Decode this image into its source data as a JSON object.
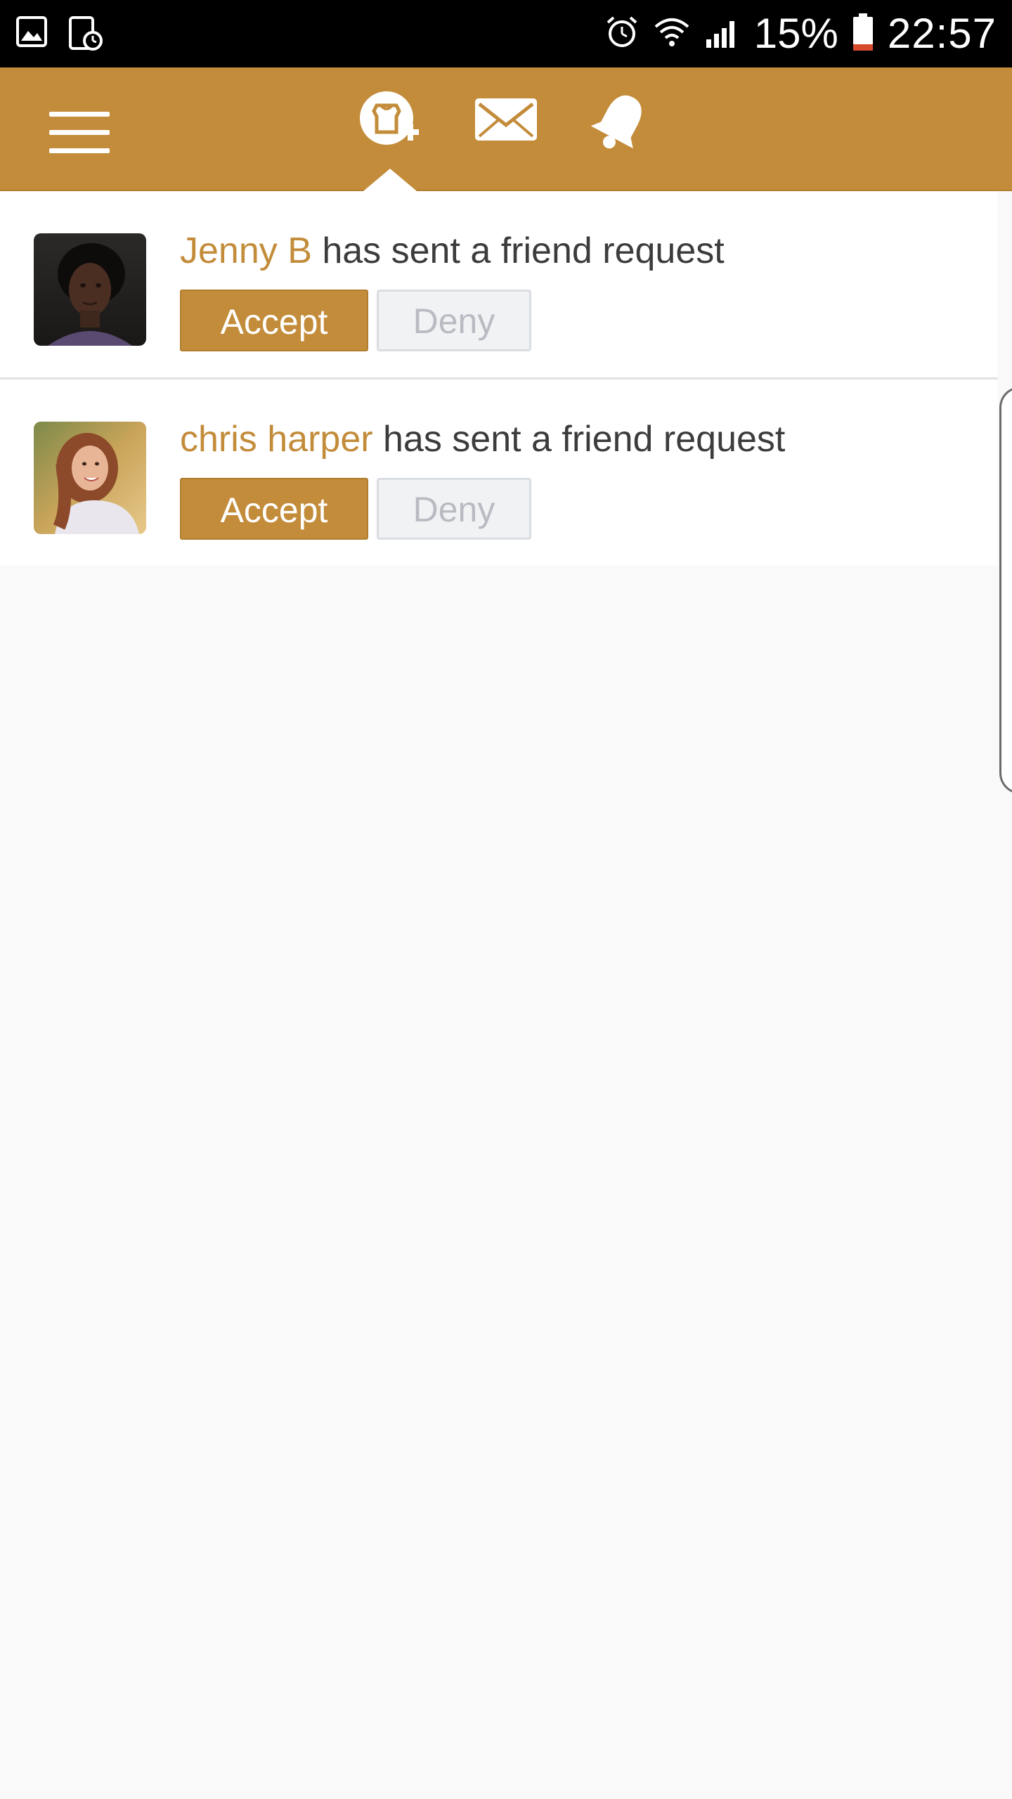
{
  "status_bar": {
    "battery_percent": "15%",
    "time": "22:57",
    "icons": [
      "gallery-icon",
      "tablet-clock-icon",
      "alarm-icon",
      "wifi-icon",
      "signal-icon",
      "battery-icon"
    ]
  },
  "header": {
    "active_tab": "friend-requests",
    "tabs": [
      {
        "name": "friend-requests",
        "icon": "add-friend-icon"
      },
      {
        "name": "messages",
        "icon": "envelope-icon"
      },
      {
        "name": "notifications",
        "icon": "bell-icon"
      }
    ]
  },
  "requests": [
    {
      "name": "Jenny B",
      "message": "has sent a friend request",
      "accept_label": "Accept",
      "deny_label": "Deny"
    },
    {
      "name": "chris harper",
      "message": "has sent a friend request",
      "accept_label": "Accept",
      "deny_label": "Deny"
    }
  ],
  "colors": {
    "accent": "#c38c3a",
    "status_bar": "#000000",
    "background": "#f9f9f9",
    "battery_low": "#d84a2c"
  }
}
